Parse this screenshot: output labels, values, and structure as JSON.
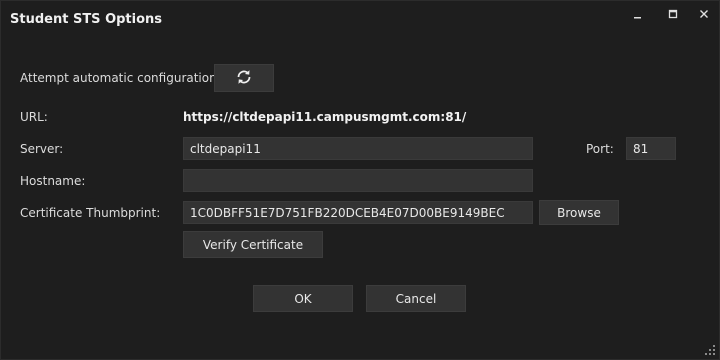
{
  "window": {
    "title": "Student STS Options",
    "controls": {
      "minimize_icon": "minimize-icon",
      "maximize_icon": "maximize-icon",
      "close_icon": "close-icon"
    }
  },
  "form": {
    "auto_config_label": "Attempt automatic configuration:",
    "auto_config_icon": "refresh-icon",
    "url_label": "URL:",
    "url_value": "https://cltdepapi11.campusmgmt.com:81/",
    "server_label": "Server:",
    "server_value": "cltdepapi11",
    "port_label": "Port:",
    "port_value": "81",
    "hostname_label": "Hostname:",
    "hostname_value": "",
    "thumbprint_label": "Certificate Thumbprint:",
    "thumbprint_value": "1C0DBFF51E7D751FB220DCEB4E07D00BE9149BEC",
    "browse_label": "Browse",
    "verify_label": "Verify Certificate"
  },
  "footer": {
    "ok_label": "OK",
    "cancel_label": "Cancel"
  },
  "colors": {
    "background": "#1e1e1e",
    "field": "#333333",
    "text": "#e6e6e6"
  }
}
